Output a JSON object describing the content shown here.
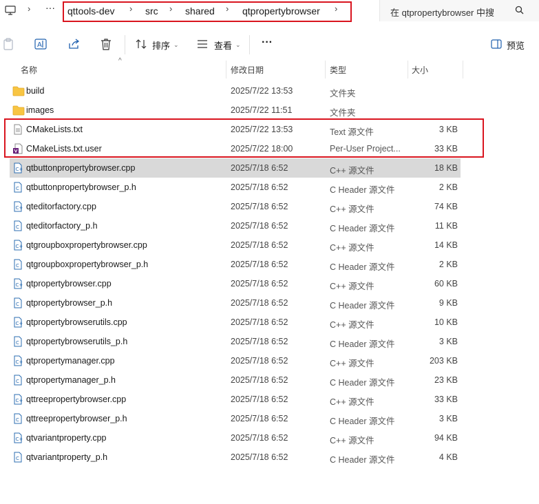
{
  "breadcrumb": {
    "items": [
      "qttools-dev",
      "src",
      "shared",
      "qtpropertybrowser"
    ]
  },
  "search": {
    "placeholder": "在 qtpropertybrowser 中搜"
  },
  "toolbar": {
    "sort_label": "排序",
    "view_label": "查看",
    "more_label": "···",
    "preview_label": "预览"
  },
  "columns": {
    "name": "名称",
    "date": "修改日期",
    "type": "类型",
    "size": "大小"
  },
  "files": [
    {
      "name": "build",
      "date": "2025/7/22 13:53",
      "type": "文件夹",
      "size": "",
      "icon": "folder-icon"
    },
    {
      "name": "images",
      "date": "2025/7/22 11:51",
      "type": "文件夹",
      "size": "",
      "icon": "folder-icon"
    },
    {
      "name": "CMakeLists.txt",
      "date": "2025/7/22 13:53",
      "type": "Text 源文件",
      "size": "3 KB",
      "icon": "text-file-icon"
    },
    {
      "name": "CMakeLists.txt.user",
      "date": "2025/7/22 18:00",
      "type": "Per-User Project...",
      "size": "33 KB",
      "icon": "vs-project-file-icon"
    },
    {
      "name": "qtbuttonpropertybrowser.cpp",
      "date": "2025/7/18 6:52",
      "type": "C++ 源文件",
      "size": "18 KB",
      "icon": "cpp-file-icon"
    },
    {
      "name": "qtbuttonpropertybrowser_p.h",
      "date": "2025/7/18 6:52",
      "type": "C Header 源文件",
      "size": "2 KB",
      "icon": "header-file-icon"
    },
    {
      "name": "qteditorfactory.cpp",
      "date": "2025/7/18 6:52",
      "type": "C++ 源文件",
      "size": "74 KB",
      "icon": "cpp-file-icon"
    },
    {
      "name": "qteditorfactory_p.h",
      "date": "2025/7/18 6:52",
      "type": "C Header 源文件",
      "size": "11 KB",
      "icon": "header-file-icon"
    },
    {
      "name": "qtgroupboxpropertybrowser.cpp",
      "date": "2025/7/18 6:52",
      "type": "C++ 源文件",
      "size": "14 KB",
      "icon": "cpp-file-icon"
    },
    {
      "name": "qtgroupboxpropertybrowser_p.h",
      "date": "2025/7/18 6:52",
      "type": "C Header 源文件",
      "size": "2 KB",
      "icon": "header-file-icon"
    },
    {
      "name": "qtpropertybrowser.cpp",
      "date": "2025/7/18 6:52",
      "type": "C++ 源文件",
      "size": "60 KB",
      "icon": "cpp-file-icon"
    },
    {
      "name": "qtpropertybrowser_p.h",
      "date": "2025/7/18 6:52",
      "type": "C Header 源文件",
      "size": "9 KB",
      "icon": "header-file-icon"
    },
    {
      "name": "qtpropertybrowserutils.cpp",
      "date": "2025/7/18 6:52",
      "type": "C++ 源文件",
      "size": "10 KB",
      "icon": "cpp-file-icon"
    },
    {
      "name": "qtpropertybrowserutils_p.h",
      "date": "2025/7/18 6:52",
      "type": "C Header 源文件",
      "size": "3 KB",
      "icon": "header-file-icon"
    },
    {
      "name": "qtpropertymanager.cpp",
      "date": "2025/7/18 6:52",
      "type": "C++ 源文件",
      "size": "203 KB",
      "icon": "cpp-file-icon"
    },
    {
      "name": "qtpropertymanager_p.h",
      "date": "2025/7/18 6:52",
      "type": "C Header 源文件",
      "size": "23 KB",
      "icon": "header-file-icon"
    },
    {
      "name": "qttreepropertybrowser.cpp",
      "date": "2025/7/18 6:52",
      "type": "C++ 源文件",
      "size": "33 KB",
      "icon": "cpp-file-icon"
    },
    {
      "name": "qttreepropertybrowser_p.h",
      "date": "2025/7/18 6:52",
      "type": "C Header 源文件",
      "size": "3 KB",
      "icon": "header-file-icon"
    },
    {
      "name": "qtvariantproperty.cpp",
      "date": "2025/7/18 6:52",
      "type": "C++ 源文件",
      "size": "94 KB",
      "icon": "cpp-file-icon"
    },
    {
      "name": "qtvariantproperty_p.h",
      "date": "2025/7/18 6:52",
      "type": "C Header 源文件",
      "size": "4 KB",
      "icon": "header-file-icon"
    }
  ],
  "selected_index": 4,
  "colors": {
    "highlight": "#d9141e",
    "selection": "#d9d9d9",
    "folder": "#f8c543"
  }
}
